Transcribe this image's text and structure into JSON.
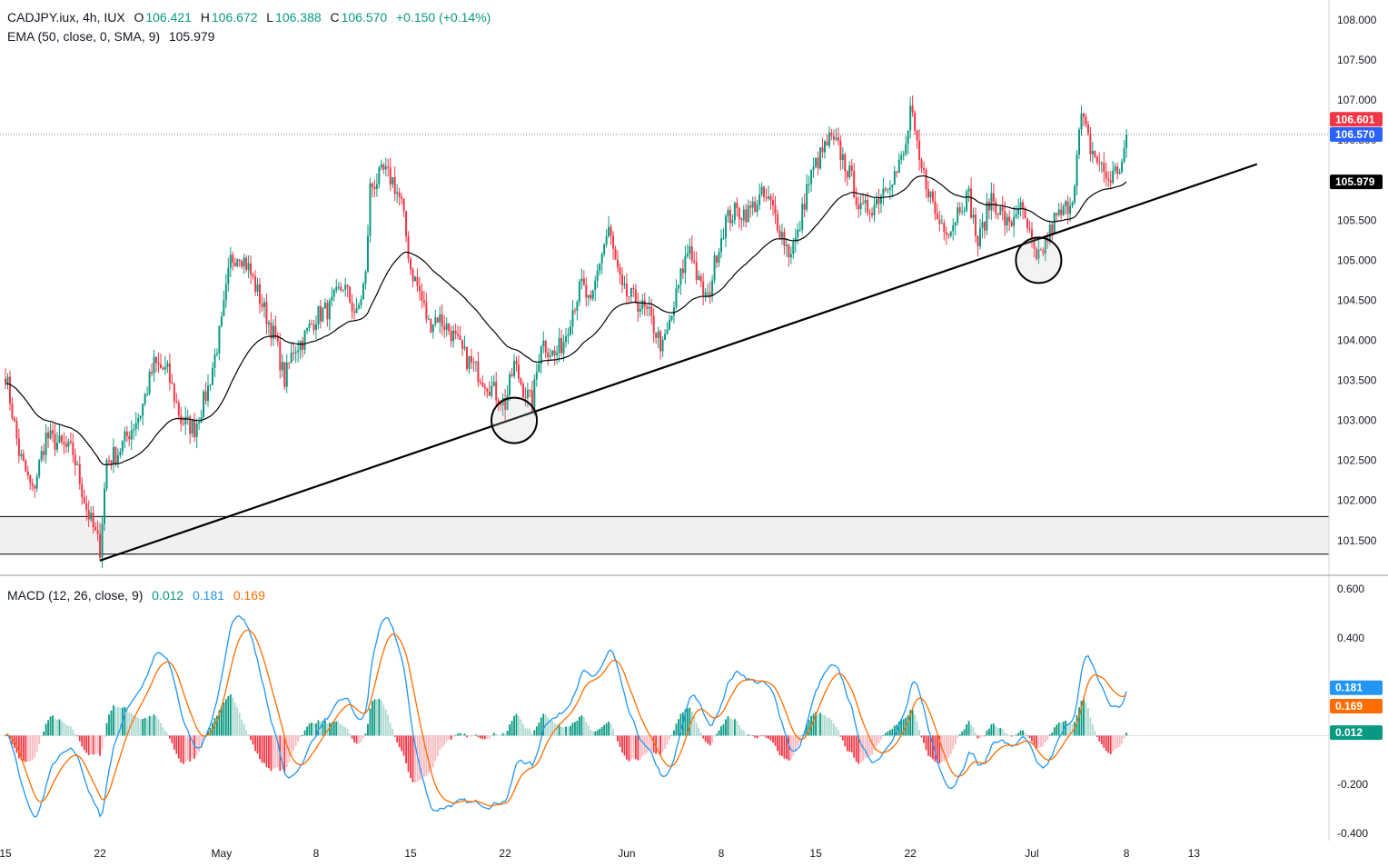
{
  "header": {
    "symbol": "CADJPY.iux, 4h, IUX",
    "open_label": "O",
    "open": "106.421",
    "high_label": "H",
    "high": "106.672",
    "low_label": "L",
    "low": "106.388",
    "close_label": "C",
    "close": "106.570",
    "change": "+0.150 (+0.14%)"
  },
  "ema_legend": {
    "label": "EMA (50, close, 0, SMA, 9)",
    "value": "105.979"
  },
  "macd_legend": {
    "label": "MACD (12, 26, close, 9)",
    "hist": "0.012",
    "macd": "0.181",
    "signal": "0.169"
  },
  "colors": {
    "up": "#089981",
    "down": "#f23645",
    "macd": "#2196f3",
    "signal": "#ff6d00",
    "hist_up_strong": "#089981",
    "hist_up_weak": "#acd8d0",
    "hist_down_strong": "#f23645",
    "hist_down_weak": "#f7b9bf",
    "ema": "#000000",
    "trendline": "#000000",
    "zone": "#f0f0f3"
  },
  "chart_data": [
    {
      "type": "candlestick",
      "title": "CADJPY.iux, 4h, IUX",
      "y_ticks": [
        "101.500",
        "102.000",
        "102.500",
        "103.000",
        "103.500",
        "104.000",
        "104.500",
        "105.000",
        "105.500",
        "106.000",
        "106.500",
        "107.000",
        "107.500",
        "108.000"
      ],
      "ylim": [
        101.1,
        108.25
      ],
      "x_ticks": [
        {
          "label": "15",
          "t": 0
        },
        {
          "label": "22",
          "t": 42
        },
        {
          "label": "May",
          "t": 96
        },
        {
          "label": "8",
          "t": 138
        },
        {
          "label": "15",
          "t": 180
        },
        {
          "label": "22",
          "t": 222
        },
        {
          "label": "Jun",
          "t": 276
        },
        {
          "label": "8",
          "t": 318
        },
        {
          "label": "15",
          "t": 360
        },
        {
          "label": "22",
          "t": 402
        },
        {
          "label": "Jul",
          "t": 456
        },
        {
          "label": "8",
          "t": 498
        },
        {
          "label": "13",
          "t": 528
        }
      ],
      "xlim": [
        -3,
        555
      ],
      "price_keypoints": [
        [
          0,
          103.6
        ],
        [
          6,
          102.6
        ],
        [
          12,
          102.1
        ],
        [
          18,
          102.8
        ],
        [
          24,
          102.7
        ],
        [
          30,
          102.6
        ],
        [
          36,
          101.9
        ],
        [
          42,
          101.4
        ],
        [
          45,
          102.5
        ],
        [
          50,
          102.6
        ],
        [
          54,
          102.8
        ],
        [
          60,
          103.1
        ],
        [
          66,
          103.7
        ],
        [
          72,
          103.6
        ],
        [
          78,
          103.0
        ],
        [
          84,
          102.9
        ],
        [
          90,
          103.4
        ],
        [
          96,
          104.2
        ],
        [
          100,
          105.0
        ],
        [
          104,
          105.1
        ],
        [
          108,
          104.9
        ],
        [
          112,
          104.6
        ],
        [
          116,
          104.3
        ],
        [
          120,
          104.0
        ],
        [
          124,
          103.5
        ],
        [
          128,
          103.9
        ],
        [
          132,
          104.0
        ],
        [
          138,
          104.3
        ],
        [
          144,
          104.4
        ],
        [
          150,
          104.7
        ],
        [
          156,
          104.3
        ],
        [
          160,
          104.8
        ],
        [
          162,
          105.9
        ],
        [
          168,
          106.1
        ],
        [
          172,
          106.0
        ],
        [
          176,
          105.7
        ],
        [
          180,
          104.9
        ],
        [
          184,
          104.6
        ],
        [
          188,
          104.2
        ],
        [
          192,
          104.3
        ],
        [
          198,
          104.1
        ],
        [
          204,
          103.8
        ],
        [
          210,
          103.6
        ],
        [
          216,
          103.4
        ],
        [
          222,
          103.2
        ],
        [
          226,
          103.7
        ],
        [
          230,
          103.4
        ],
        [
          234,
          103.2
        ],
        [
          238,
          104.0
        ],
        [
          244,
          103.8
        ],
        [
          248,
          104.0
        ],
        [
          252,
          104.4
        ],
        [
          256,
          104.7
        ],
        [
          260,
          104.4
        ],
        [
          264,
          105.0
        ],
        [
          268,
          105.4
        ],
        [
          270,
          105.1
        ],
        [
          274,
          104.6
        ],
        [
          280,
          104.5
        ],
        [
          286,
          104.3
        ],
        [
          292,
          103.9
        ],
        [
          296,
          104.3
        ],
        [
          300,
          104.8
        ],
        [
          304,
          105.2
        ],
        [
          308,
          104.7
        ],
        [
          312,
          104.5
        ],
        [
          316,
          105.1
        ],
        [
          320,
          105.5
        ],
        [
          324,
          105.6
        ],
        [
          330,
          105.6
        ],
        [
          336,
          105.8
        ],
        [
          340,
          105.7
        ],
        [
          344,
          105.4
        ],
        [
          348,
          105.1
        ],
        [
          352,
          105.3
        ],
        [
          356,
          105.9
        ],
        [
          360,
          106.2
        ],
        [
          366,
          106.5
        ],
        [
          370,
          106.4
        ],
        [
          376,
          106.0
        ],
        [
          380,
          105.6
        ],
        [
          386,
          105.7
        ],
        [
          392,
          106.0
        ],
        [
          396,
          106.1
        ],
        [
          400,
          106.4
        ],
        [
          402,
          106.9
        ],
        [
          406,
          106.2
        ],
        [
          410,
          105.9
        ],
        [
          414,
          105.5
        ],
        [
          420,
          105.4
        ],
        [
          424,
          105.7
        ],
        [
          428,
          105.8
        ],
        [
          432,
          105.2
        ],
        [
          438,
          105.8
        ],
        [
          442,
          105.6
        ],
        [
          446,
          105.4
        ],
        [
          450,
          105.7
        ],
        [
          454,
          105.4
        ],
        [
          458,
          104.95
        ],
        [
          462,
          105.2
        ],
        [
          466,
          105.5
        ],
        [
          470,
          105.6
        ],
        [
          474,
          105.8
        ],
        [
          478,
          106.8
        ],
        [
          482,
          106.4
        ],
        [
          486,
          106.2
        ],
        [
          490,
          106.0
        ],
        [
          496,
          106.2
        ],
        [
          498,
          106.57
        ]
      ],
      "last_price": 106.57,
      "ema_value": 105.979,
      "price_tag": "106.601",
      "close_tag": "106.570",
      "ema_tag": "105.979",
      "zone": [
        101.33,
        101.8
      ],
      "trendline": {
        "from": [
          42,
          101.25
        ],
        "to": [
          556,
          106.2
        ]
      },
      "circles": [
        {
          "t": 226,
          "price": 103.0
        },
        {
          "t": 459,
          "price": 105.0
        }
      ]
    },
    {
      "type": "macd",
      "title": "MACD (12, 26, close, 9)",
      "y_ticks": [
        "-0.400",
        "-0.200",
        "0.400",
        "0.600"
      ],
      "ylim": [
        -0.43,
        0.645
      ],
      "series": [
        {
          "name": "MACD",
          "color": "#2196f3"
        },
        {
          "name": "Signal",
          "color": "#ff6d00"
        },
        {
          "name": "Histogram"
        }
      ],
      "macd_value": 0.181,
      "signal_value": 0.169,
      "hist_value": 0.012,
      "macd_tag": "0.181",
      "signal_tag": "0.169",
      "hist_tag": "0.012"
    }
  ]
}
